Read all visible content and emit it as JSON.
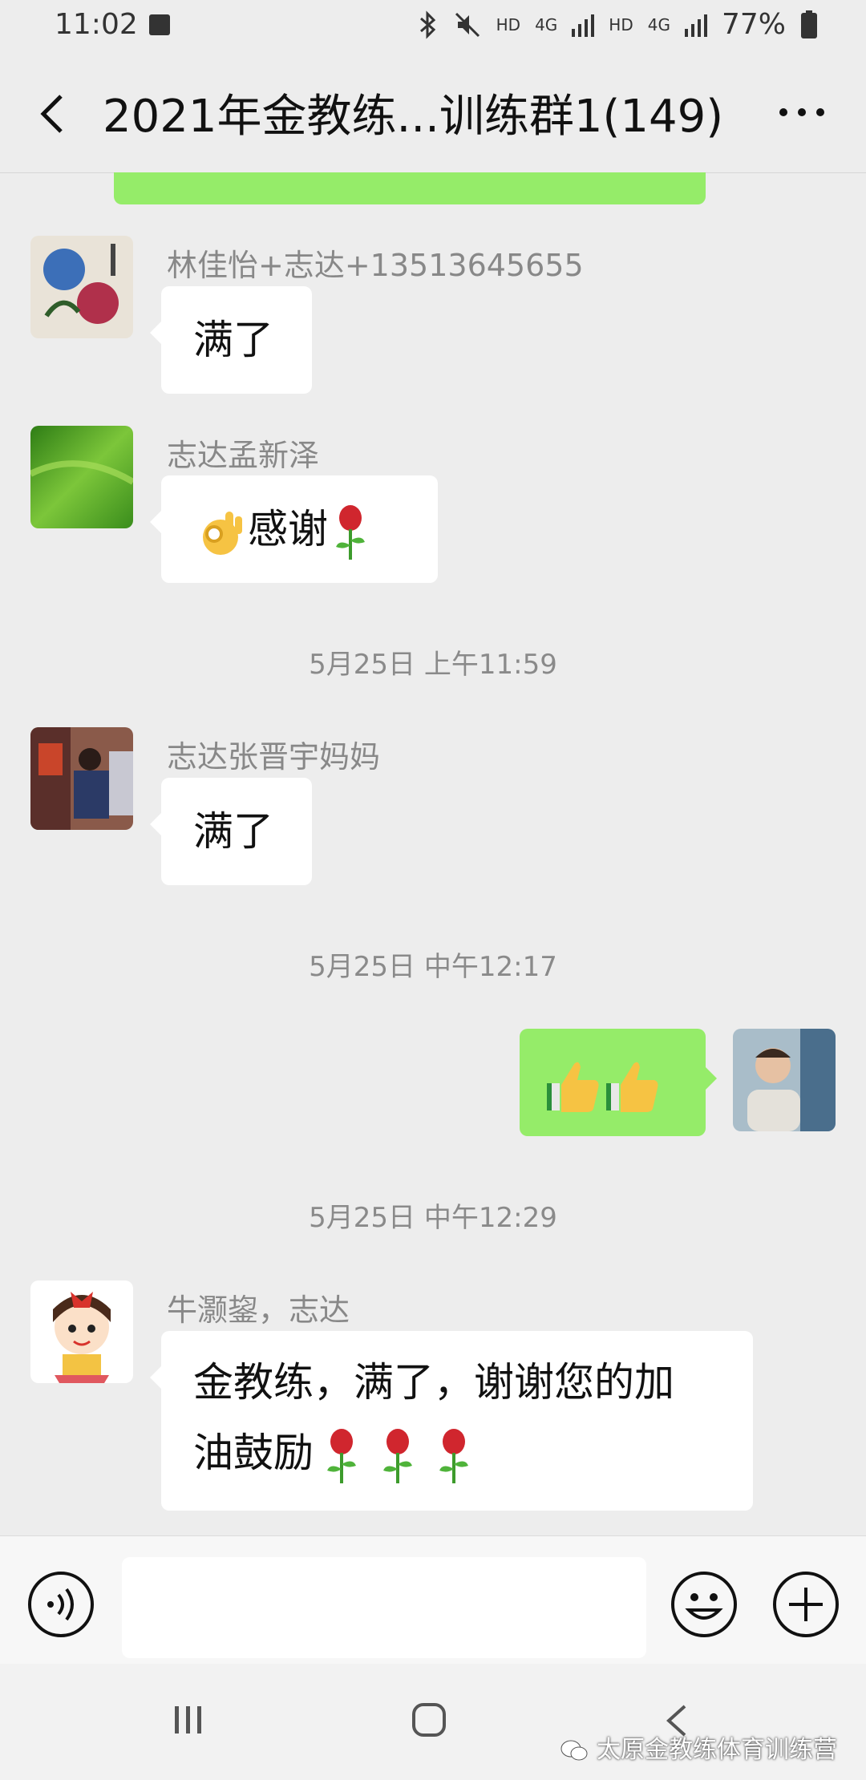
{
  "status_bar": {
    "time": "11:02",
    "network_a": "HD",
    "network_b": "4G",
    "network_c": "HD",
    "network_d": "4G",
    "battery": "77%"
  },
  "header": {
    "title": "2021年金教练...训练群1(149)"
  },
  "messages": [
    {
      "sender": "林佳怡+志达+13513645655",
      "text": "满了"
    },
    {
      "sender": "志达孟新泽",
      "text": "感谢"
    },
    {
      "sender": "志达张晋宇妈妈",
      "text": "满了"
    },
    {
      "sender": "牛灏鋆，志达",
      "text_line1": "金教练，满了，谢谢您的加",
      "text_line2": "油鼓励"
    }
  ],
  "timestamps": [
    "5月25日 上午11:59",
    "5月25日 中午12:17",
    "5月25日 中午12:29"
  ],
  "watermark": "太原金教练体育训练营",
  "colors": {
    "background": "#ededed",
    "my_bubble": "#95ec69",
    "other_bubble": "#ffffff"
  },
  "icons": [
    "back-arrow-icon",
    "more-icon",
    "voice-icon",
    "emoji-icon",
    "plus-icon",
    "ok-hand-emoji",
    "rose-emoji",
    "thumbs-up-emoji"
  ]
}
